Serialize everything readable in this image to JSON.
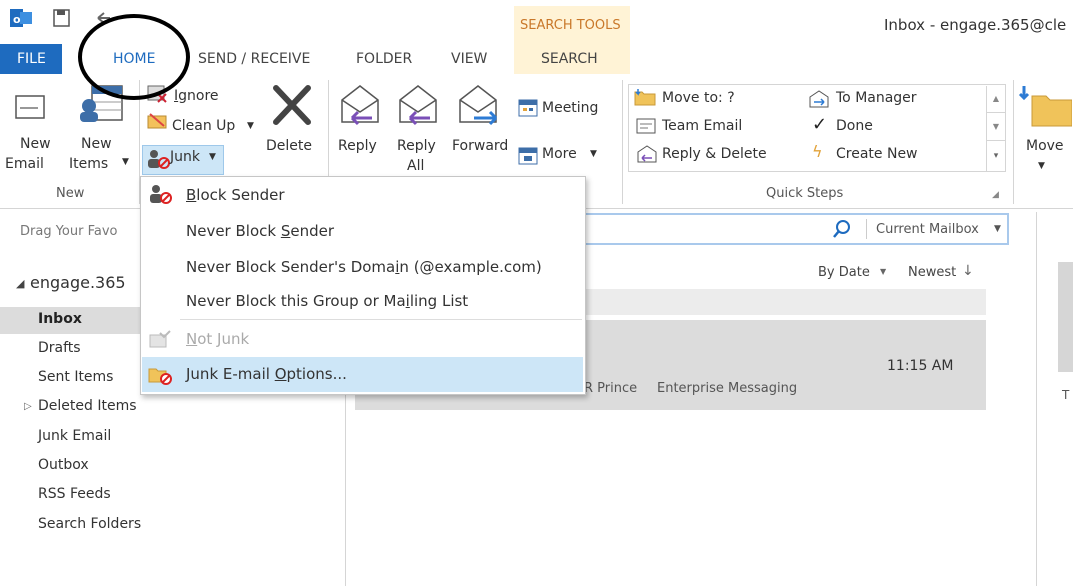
{
  "title_bar": {
    "title": "Inbox - engage.365@cle"
  },
  "contextual": {
    "header": "SEARCH TOOLS",
    "tab": "SEARCH"
  },
  "tabs": {
    "file": "FILE",
    "home": "HOME",
    "send_receive": "SEND / RECEIVE",
    "folder": "FOLDER",
    "view": "VIEW"
  },
  "ribbon": {
    "new_email_1": "New",
    "new_email_2": "Email",
    "new_items_1": "New",
    "new_items_2": "Items",
    "group_new": "New",
    "ignore": "Ignore",
    "clean_up": "Clean Up",
    "junk": "Junk",
    "delete": "Delete",
    "reply": "Reply",
    "reply_all_1": "Reply",
    "reply_all_2": "All",
    "forward": "Forward",
    "meeting": "Meeting",
    "more": "More",
    "qs_move_to": "Move to: ?",
    "qs_team_email": "Team Email",
    "qs_reply_delete": "Reply & Delete",
    "qs_to_manager": "To Manager",
    "qs_done": "Done",
    "qs_create_new": "Create New",
    "group_quick_steps": "Quick Steps",
    "move": "Move"
  },
  "nav": {
    "favorites_hint": "Drag Your Favo",
    "account": "engage.365",
    "folders": [
      "Inbox",
      "Drafts",
      "Sent Items",
      "Deleted Items",
      "Junk Email",
      "Outbox",
      "RSS Feeds",
      "Search Folders"
    ]
  },
  "search": {
    "scope": "Current Mailbox"
  },
  "list": {
    "sort_by": "By Date",
    "order": "Newest"
  },
  "message": {
    "time": "11:15 AM",
    "from_fragment": "R Prince",
    "subject": "Enterprise Messaging"
  },
  "reading_pane": {
    "fragment": "T"
  },
  "junk_menu": {
    "block_sender": "Block Sender",
    "never_block_sender": "Never Block Sender",
    "never_block_domain": "Never Block Sender's Domain (@example.com)",
    "never_block_group": "Never Block this Group or Mailing List",
    "not_junk": "Not Junk",
    "junk_options": "Junk E-mail Options..."
  },
  "colors": {
    "accent": "#1e6bbf",
    "contextual_bg": "#fff3d6",
    "menu_highlight": "#cde6f7"
  }
}
